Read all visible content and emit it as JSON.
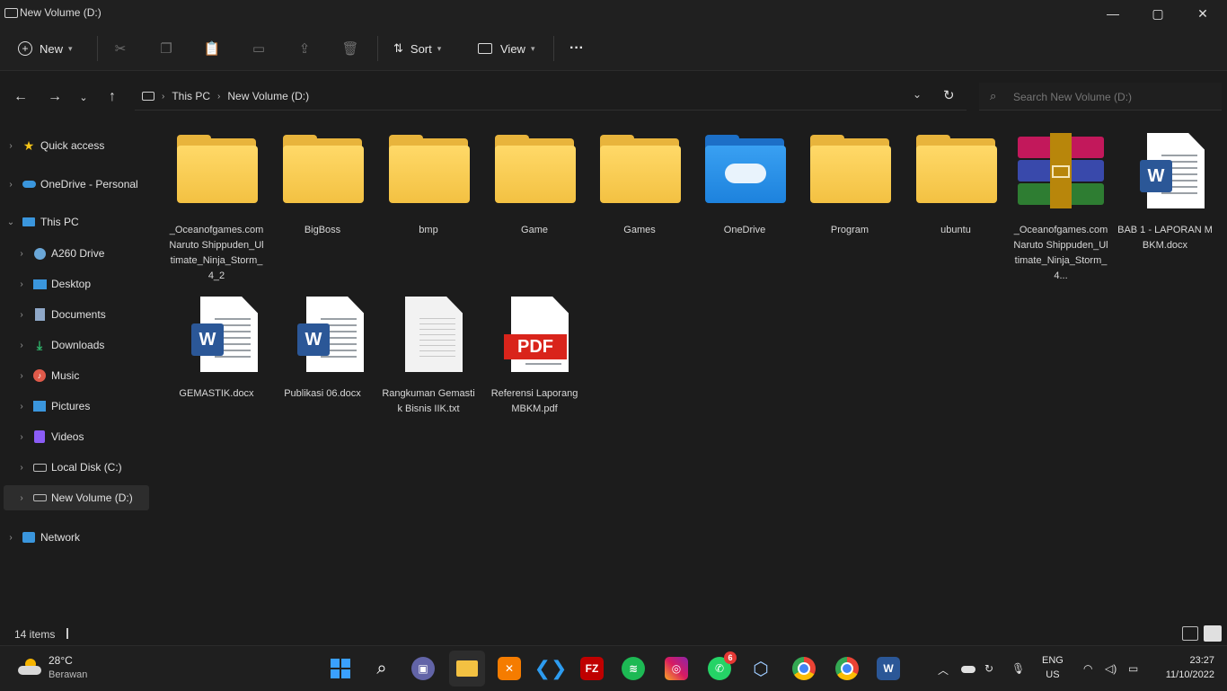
{
  "window": {
    "title": "New Volume (D:)",
    "controls": {
      "minimize": "—",
      "maximize": "▢",
      "close": "✕"
    }
  },
  "toolbar": {
    "new_label": "New",
    "sort_label": "Sort",
    "view_label": "View",
    "more_label": "···",
    "icons": [
      "cut-icon",
      "copy-icon",
      "paste-icon",
      "rename-icon",
      "share-icon",
      "delete-icon"
    ]
  },
  "address": {
    "crumbs": [
      "This PC",
      "New Volume (D:)"
    ]
  },
  "search": {
    "placeholder": "Search New Volume (D:)"
  },
  "sidebar": {
    "items": [
      {
        "label": "Quick access",
        "icon": "star-icon",
        "color": "#f5c518"
      },
      {
        "label": "OneDrive - Personal",
        "icon": "cloud-icon",
        "color": "#3a96dd"
      },
      {
        "label": "This PC",
        "icon": "monitor-icon",
        "color": "#3a96dd"
      },
      {
        "label": "A260 Drive",
        "icon": "network-drive-icon",
        "color": "#6aa7d8"
      },
      {
        "label": "Desktop",
        "icon": "desktop-icon",
        "color": "#3a96dd"
      },
      {
        "label": "Documents",
        "icon": "document-icon",
        "color": "#8fa8c8"
      },
      {
        "label": "Downloads",
        "icon": "download-icon",
        "color": "#2fb36b"
      },
      {
        "label": "Music",
        "icon": "music-icon",
        "color": "#e05a4a"
      },
      {
        "label": "Pictures",
        "icon": "pictures-icon",
        "color": "#3a96dd"
      },
      {
        "label": "Videos",
        "icon": "video-icon",
        "color": "#8b5cf6"
      },
      {
        "label": "Local Disk (C:)",
        "icon": "disk-icon",
        "color": "#9a9a9a"
      },
      {
        "label": "New Volume (D:)",
        "icon": "drive-icon",
        "color": "#9a9a9a"
      },
      {
        "label": "Network",
        "icon": "network-icon",
        "color": "#3a96dd"
      }
    ]
  },
  "files": [
    {
      "name": "_Oceanofgames.com Naruto Shippuden_Ultimate_Ninja_Storm_4_2",
      "type": "folder"
    },
    {
      "name": "BigBoss",
      "type": "folder"
    },
    {
      "name": "bmp",
      "type": "folder"
    },
    {
      "name": "Game",
      "type": "folder"
    },
    {
      "name": "Games",
      "type": "folder"
    },
    {
      "name": "OneDrive",
      "type": "onedrive-folder"
    },
    {
      "name": "Program",
      "type": "folder"
    },
    {
      "name": "ubuntu",
      "type": "folder"
    },
    {
      "name": "_Oceanofgames.com Naruto Shippuden_Ultimate_Ninja_Storm_4...",
      "type": "rar"
    },
    {
      "name": "BAB 1 - LAPORAN MBKM.docx",
      "type": "word"
    },
    {
      "name": "GEMASTIK.docx",
      "type": "word"
    },
    {
      "name": "Publikasi 06.docx",
      "type": "word"
    },
    {
      "name": "Rangkuman Gemastik Bisnis IIK.txt",
      "type": "text"
    },
    {
      "name": "Referensi Laporang MBKM.pdf",
      "type": "pdf"
    }
  ],
  "pdf_badge": "PDF",
  "word_badge": "W",
  "status": {
    "items": "14 items"
  },
  "taskbar": {
    "weather_temp": "28°C",
    "weather_desc": "Berawan",
    "whatsapp_badge": "6",
    "lang": "ENG",
    "region": "US",
    "time": "23:27",
    "date": "11/10/2022"
  }
}
